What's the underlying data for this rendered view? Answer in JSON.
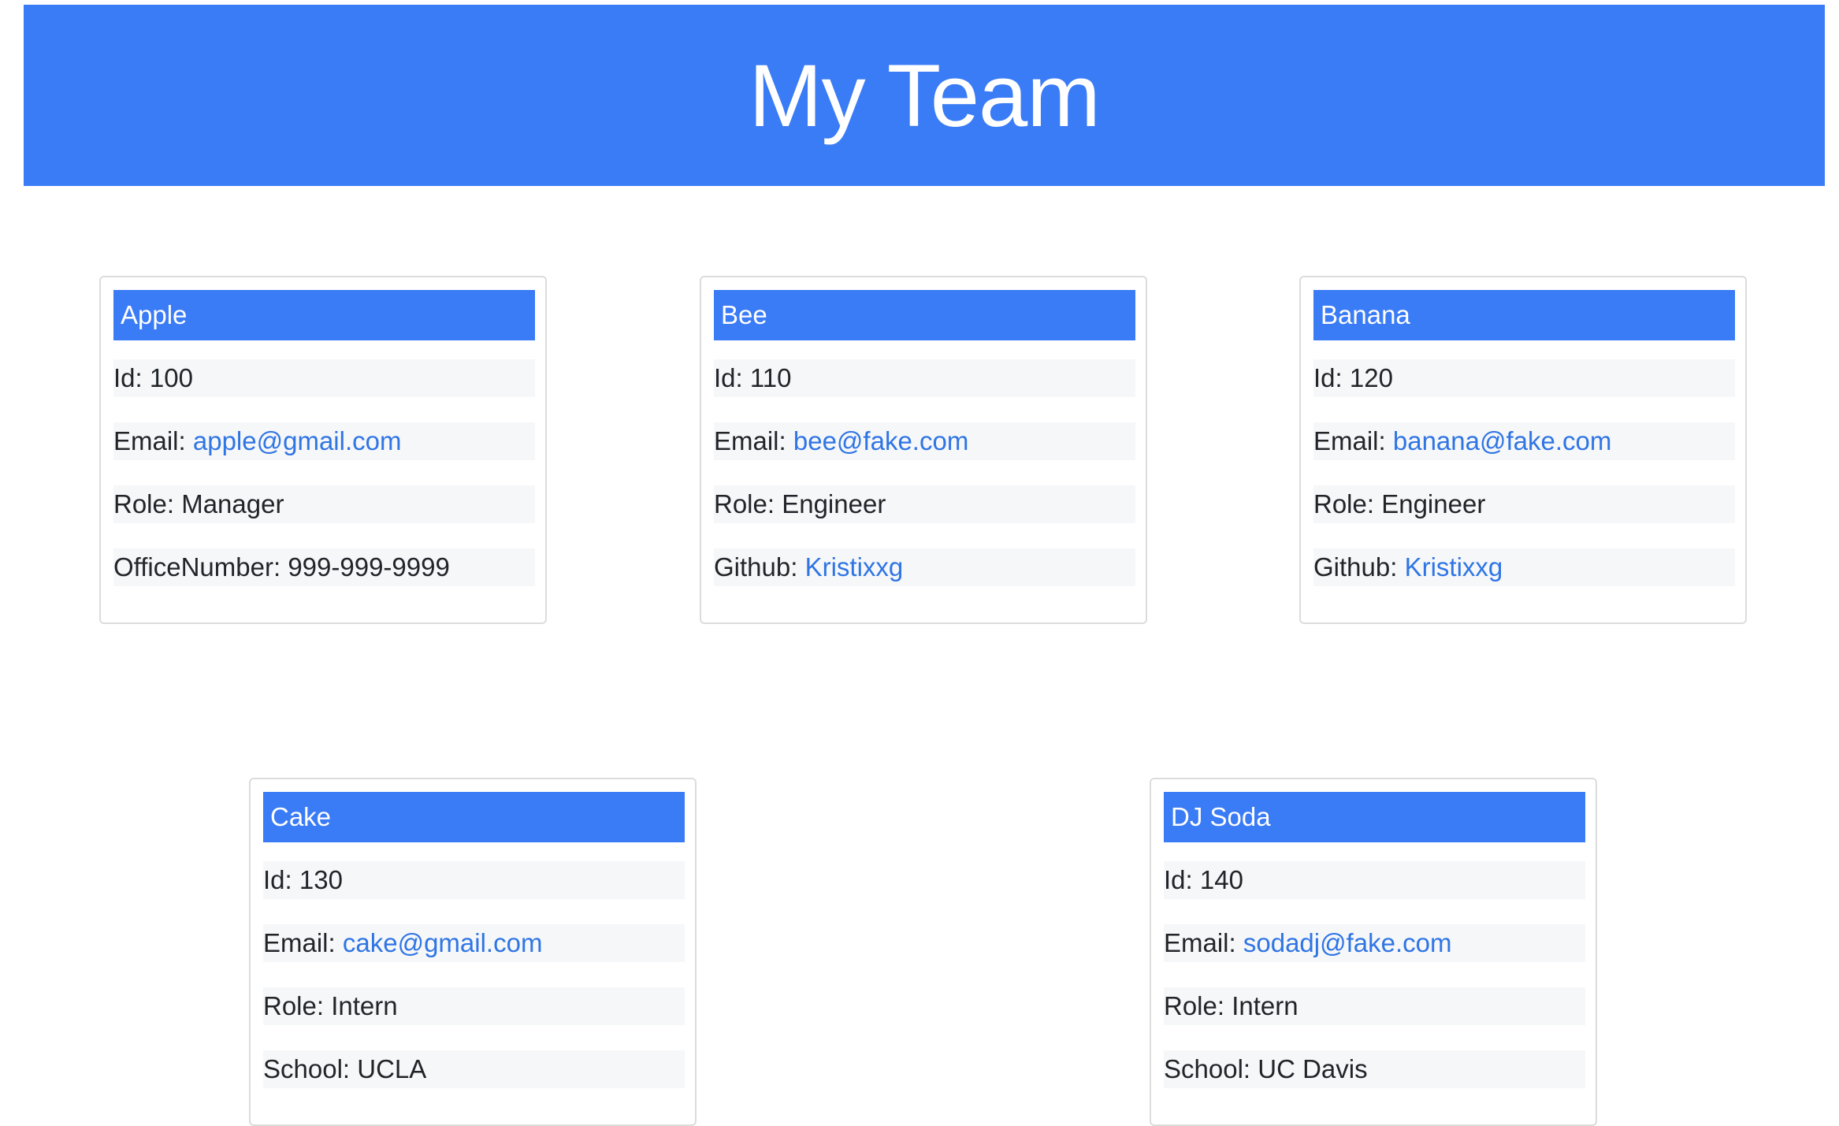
{
  "header": {
    "title": "My Team"
  },
  "employees": [
    {
      "name": "Apple",
      "id_label": "Id: ",
      "id": "100",
      "email_label": "Email: ",
      "email": "apple@gmail.com",
      "role_label": "Role: ",
      "role": "Manager",
      "extra_label": "OfficeNumber: ",
      "extra": "999-999-9999"
    },
    {
      "name": "Bee",
      "id_label": "Id: ",
      "id": "110",
      "email_label": "Email: ",
      "email": "bee@fake.com",
      "role_label": "Role: ",
      "role": "Engineer",
      "extra_label": "Github: ",
      "extra": "Kristixxg"
    },
    {
      "name": "Banana",
      "id_label": "Id: ",
      "id": "120",
      "email_label": "Email: ",
      "email": "banana@fake.com",
      "role_label": "Role: ",
      "role": "Engineer",
      "extra_label": "Github: ",
      "extra": "Kristixxg"
    },
    {
      "name": "Cake",
      "id_label": "Id: ",
      "id": "130",
      "email_label": "Email: ",
      "email": "cake@gmail.com",
      "role_label": "Role: ",
      "role": "Intern",
      "extra_label": "School: ",
      "extra": "UCLA"
    },
    {
      "name": "DJ Soda",
      "id_label": "Id: ",
      "id": "140",
      "email_label": "Email: ",
      "email": "sodadj@fake.com",
      "role_label": "Role: ",
      "role": "Intern",
      "extra_label": "School: ",
      "extra": "UC Davis"
    }
  ],
  "colors": {
    "accent": "#3a7bf6",
    "link": "#2f75e4",
    "row_bg": "#f6f7f9"
  }
}
